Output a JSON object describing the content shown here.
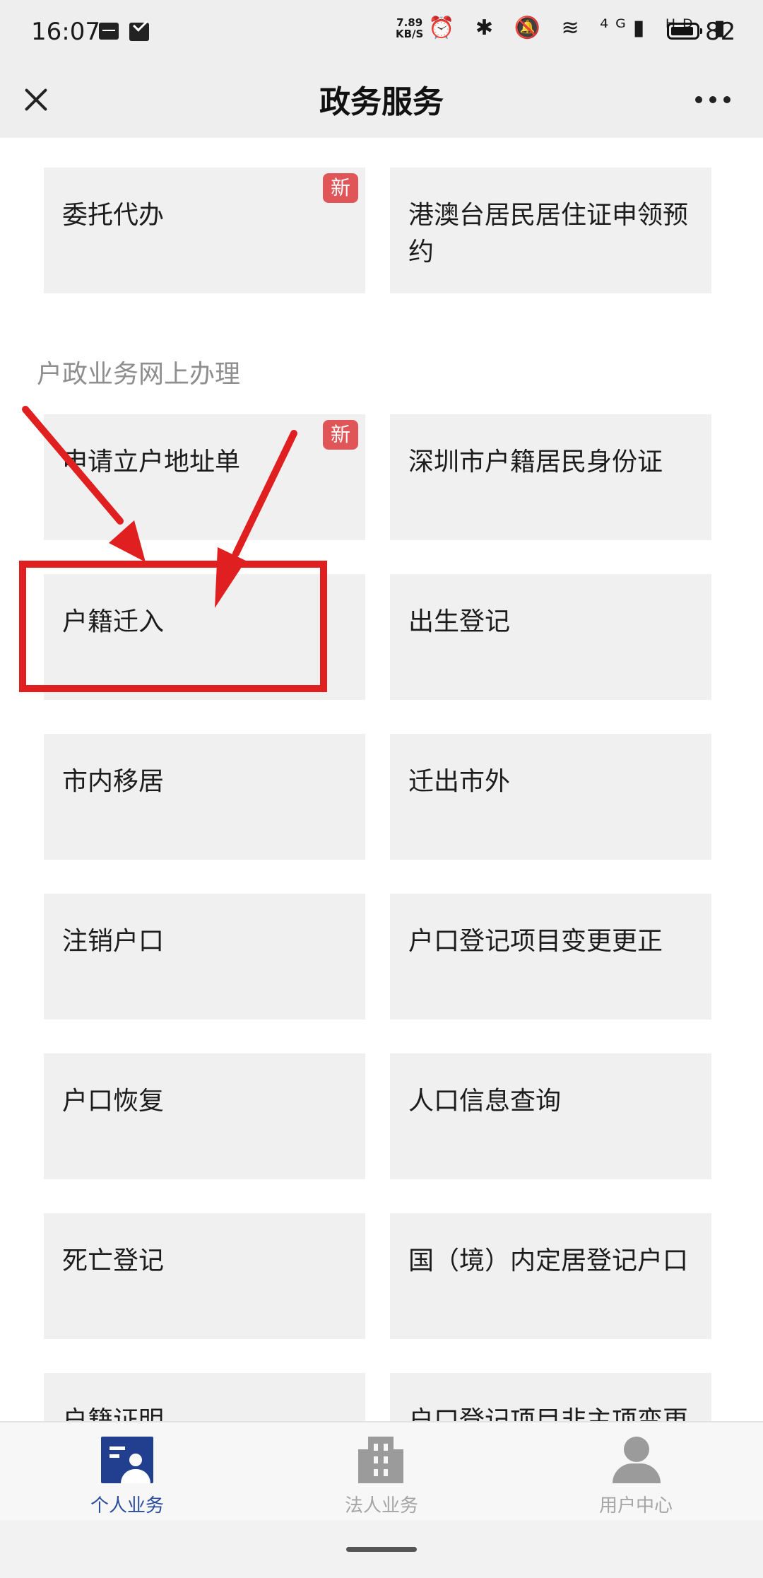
{
  "status_bar": {
    "time": "16:07",
    "net_speed_value": "7.89",
    "net_speed_unit": "KB/S",
    "glyphs": "⏰ ✱ 🔕 ≋ ⁴ᴳ▮ ᴴᴰ ▮",
    "battery": "82"
  },
  "nav": {
    "title": "政务服务"
  },
  "top_cards": [
    {
      "label": "委托代办",
      "badge": "新"
    },
    {
      "label": "港澳台居民居住证申领预约"
    }
  ],
  "section": {
    "title": "户政业务网上办理",
    "cards": [
      {
        "label": "申请立户地址单",
        "badge": "新"
      },
      {
        "label": "深圳市户籍居民身份证"
      },
      {
        "label": "户籍迁入"
      },
      {
        "label": "出生登记"
      },
      {
        "label": "市内移居"
      },
      {
        "label": "迁出市外"
      },
      {
        "label": "注销户口"
      },
      {
        "label": "户口登记项目变更更正"
      },
      {
        "label": "户口恢复"
      },
      {
        "label": "人口信息查询"
      },
      {
        "label": "死亡登记"
      },
      {
        "label": "国（境）内定居登记户口"
      },
      {
        "label": "户籍证明"
      },
      {
        "label": "户口登记项目非主项变更"
      }
    ]
  },
  "annotation": {
    "color": "#e02020"
  },
  "tabs": [
    {
      "label": "个人业务",
      "icon": "personal-icon",
      "active": true
    },
    {
      "label": "法人业务",
      "icon": "building-icon",
      "active": false
    },
    {
      "label": "用户中心",
      "icon": "user-icon",
      "active": false
    }
  ],
  "colors": {
    "accent": "#2b4c9c",
    "badge": "#e05558",
    "card_bg": "#f0f0f0"
  }
}
